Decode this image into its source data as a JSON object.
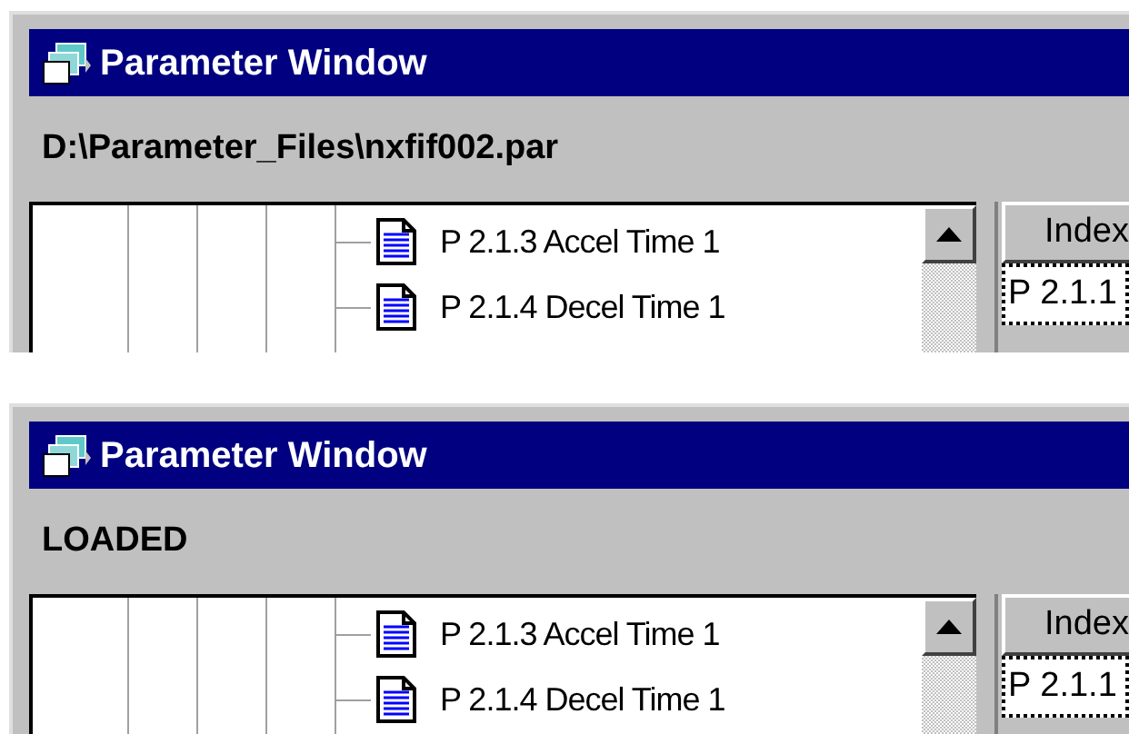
{
  "panels": [
    {
      "window": {
        "title": "Parameter Window"
      },
      "status": "D:\\Parameter_Files\\nxfif002.par",
      "tree": {
        "items": [
          {
            "label": "P 2.1.3 Accel Time 1"
          },
          {
            "label": "P 2.1.4 Decel Time 1"
          }
        ]
      },
      "table": {
        "columns": [
          "Index"
        ],
        "rows": [
          {
            "cells": [
              "P 2.1.1"
            ],
            "selected": true
          }
        ]
      }
    },
    {
      "window": {
        "title": "Parameter Window"
      },
      "status": "LOADED",
      "tree": {
        "items": [
          {
            "label": "P 2.1.3 Accel Time 1"
          },
          {
            "label": "P 2.1.4 Decel Time 1"
          }
        ]
      },
      "table": {
        "columns": [
          "Index"
        ],
        "rows": [
          {
            "cells": [
              "P 2.1.1"
            ],
            "selected": true
          }
        ]
      }
    }
  ]
}
